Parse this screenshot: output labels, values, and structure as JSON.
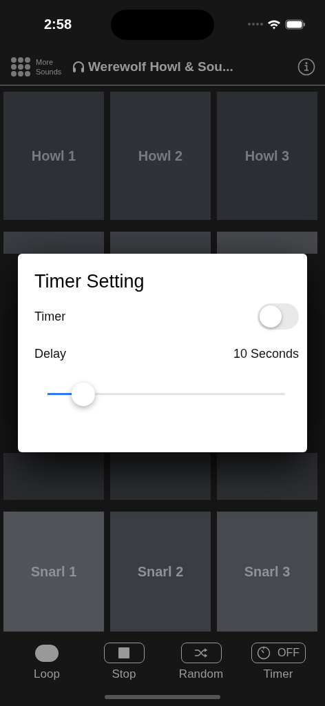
{
  "status_bar": {
    "time": "2:58"
  },
  "header": {
    "more_label": "More Sounds",
    "title": "Werewolf Howl & Sou..."
  },
  "pads": [
    {
      "label": "Howl 1",
      "color": "#2d3035"
    },
    {
      "label": "Howl 2",
      "color": "#2f3237"
    },
    {
      "label": "Howl 3",
      "color": "#2b2e33"
    },
    {
      "color": "#3a3d42"
    },
    {
      "color": "#3d4045"
    },
    {
      "color": "#47494e"
    },
    {
      "color": "#2a2c30"
    },
    {
      "color": "#2c2e32"
    },
    {
      "color": "#2e3034"
    },
    {
      "label": "Snarl 1",
      "color": "#505357"
    },
    {
      "label": "Snarl 2",
      "color": "#3a3d42"
    },
    {
      "label": "Snarl 3",
      "color": "#46494e"
    }
  ],
  "dialog": {
    "title": "Timer Setting",
    "timer_label": "Timer",
    "timer_on": false,
    "delay_label": "Delay",
    "delay_value": "10 Seconds",
    "delay_slider": {
      "level": 0.15
    }
  },
  "toolbar": [
    {
      "kind": "loop",
      "label": "Loop"
    },
    {
      "kind": "stop",
      "label": "Stop"
    },
    {
      "kind": "random",
      "label": "Random"
    },
    {
      "kind": "timer",
      "label": "Timer",
      "badge": "OFF"
    }
  ]
}
